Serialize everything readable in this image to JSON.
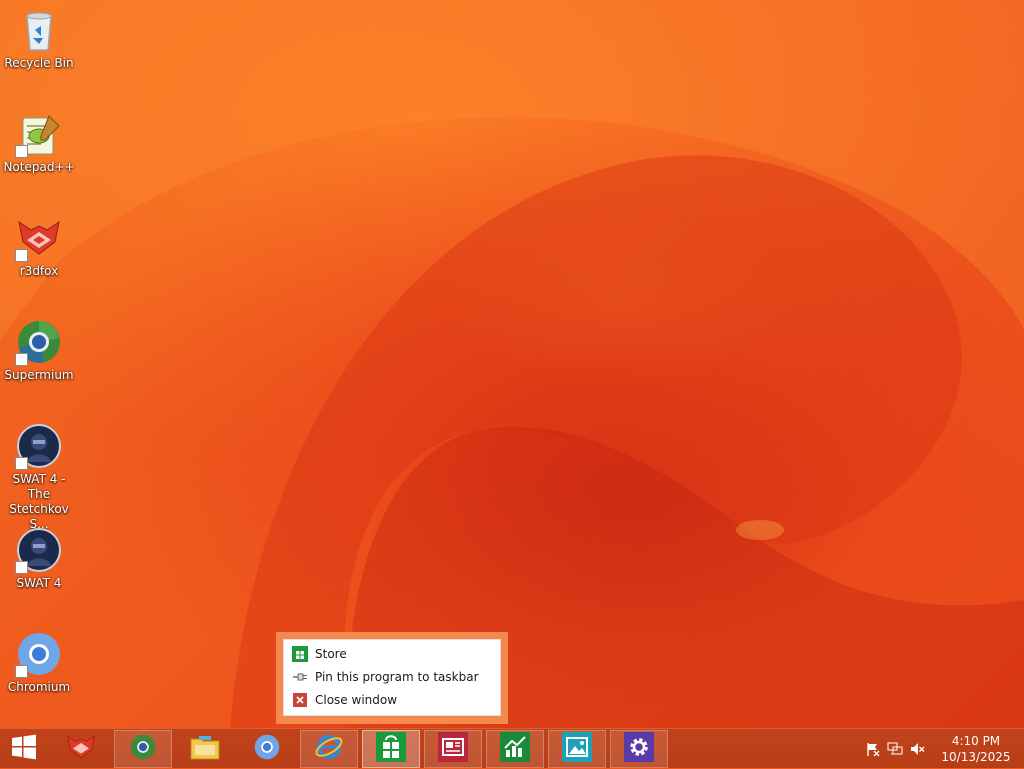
{
  "desktop": {
    "icons": [
      {
        "label": "Recycle Bin"
      },
      {
        "label": "Notepad++"
      },
      {
        "label": "r3dfox"
      },
      {
        "label": "Supermium"
      },
      {
        "label": "SWAT 4 - The Stetchkov S..."
      },
      {
        "label": "SWAT 4"
      },
      {
        "label": "Chromium"
      }
    ]
  },
  "context_menu": {
    "items": [
      {
        "label": "Store",
        "icon": "store-icon"
      },
      {
        "label": "Pin this program to taskbar",
        "icon": "pin-icon"
      },
      {
        "label": "Close window",
        "icon": "close-icon"
      }
    ]
  },
  "taskbar": {
    "buttons": [
      "start-icon",
      "r3dfox-icon",
      "supermium-icon",
      "file-explorer-icon",
      "chromium-icon",
      "internet-explorer-icon",
      "store-icon",
      "news-icon",
      "finance-icon",
      "photos-icon",
      "settings-icon"
    ]
  },
  "tray": {
    "time": "4:10 PM",
    "date": "10/13/2025",
    "icons": [
      "action-center-flag-icon",
      "network-icon",
      "volume-muted-icon"
    ]
  },
  "colors": {
    "accent": "#ee5b1c",
    "taskbar": "#bd4018",
    "menu_frame": "#f5884d"
  }
}
